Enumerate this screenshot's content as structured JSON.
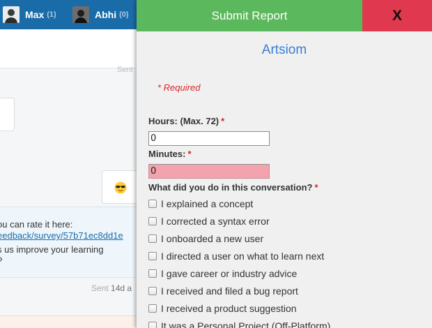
{
  "background_chat": {
    "users": [
      {
        "name": "Max",
        "count": "(1)"
      },
      {
        "name": "Abhi",
        "count": "(0)"
      }
    ],
    "sent_label_top": "Sent",
    "emoji": "sunglasses-face",
    "survey_message": {
      "line1": "ou can rate it here:",
      "line2": "eedback/survey/57b71ec8dd1e",
      "line3": "s us improve your learning",
      "line4": "?"
    },
    "sent_label": "Sent",
    "sent_ago": "14d a"
  },
  "panel": {
    "submit_label": "Submit Report",
    "close_label": "X",
    "title": "Artsiom",
    "required_note": "* Required",
    "hours": {
      "label": "Hours: (Max. 72)",
      "required_mark": "*",
      "value": "0"
    },
    "minutes": {
      "label": "Minutes:",
      "required_mark": "*",
      "value": "0"
    },
    "question": {
      "label": "What did you do in this conversation?",
      "required_mark": "*"
    },
    "options": [
      {
        "label": "I explained a concept",
        "checked": false
      },
      {
        "label": "I corrected a syntax error",
        "checked": false
      },
      {
        "label": "I onboarded a new user",
        "checked": false
      },
      {
        "label": "I directed a user on what to learn next",
        "checked": false
      },
      {
        "label": "I gave career or industry advice",
        "checked": false
      },
      {
        "label": "I received and filed a bug report",
        "checked": false
      },
      {
        "label": "I received a product suggestion",
        "checked": false
      },
      {
        "label": "It was a Personal Project (Off-Platform)",
        "checked": false
      }
    ]
  },
  "colors": {
    "topbar": "#1a6ca9",
    "submit": "#5cb85c",
    "close": "#e0394f",
    "title": "#3a7dd6",
    "required": "#d9272e",
    "invalid_field": "#f2a3ad"
  }
}
